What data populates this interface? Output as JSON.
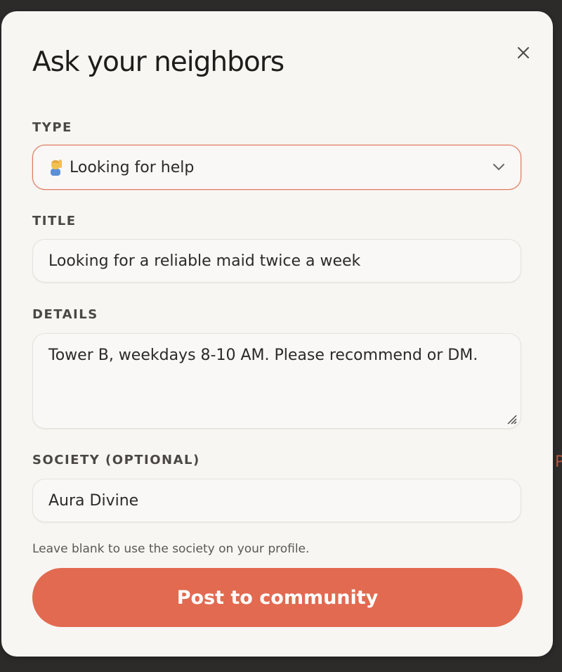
{
  "background_peek_text": "P",
  "modal": {
    "title": "Ask your neighbors",
    "close_icon": "close-icon"
  },
  "type_field": {
    "label": "TYPE",
    "selected": "Looking for help",
    "icon": "person-raising-hand-emoji"
  },
  "title_field": {
    "label": "TITLE",
    "value": "Looking for a reliable maid twice a week"
  },
  "details_field": {
    "label": "DETAILS",
    "value": "Tower B, weekdays 8-10 AM. Please recommend or DM."
  },
  "society_field": {
    "label": "SOCIETY (OPTIONAL)",
    "value": "Aura Divine",
    "hint": "Leave blank to use the society on your profile."
  },
  "submit_label": "Post to community",
  "colors": {
    "accent": "#e26a50",
    "background": "#f8f6f3",
    "backdrop": "#2c2b2a"
  }
}
